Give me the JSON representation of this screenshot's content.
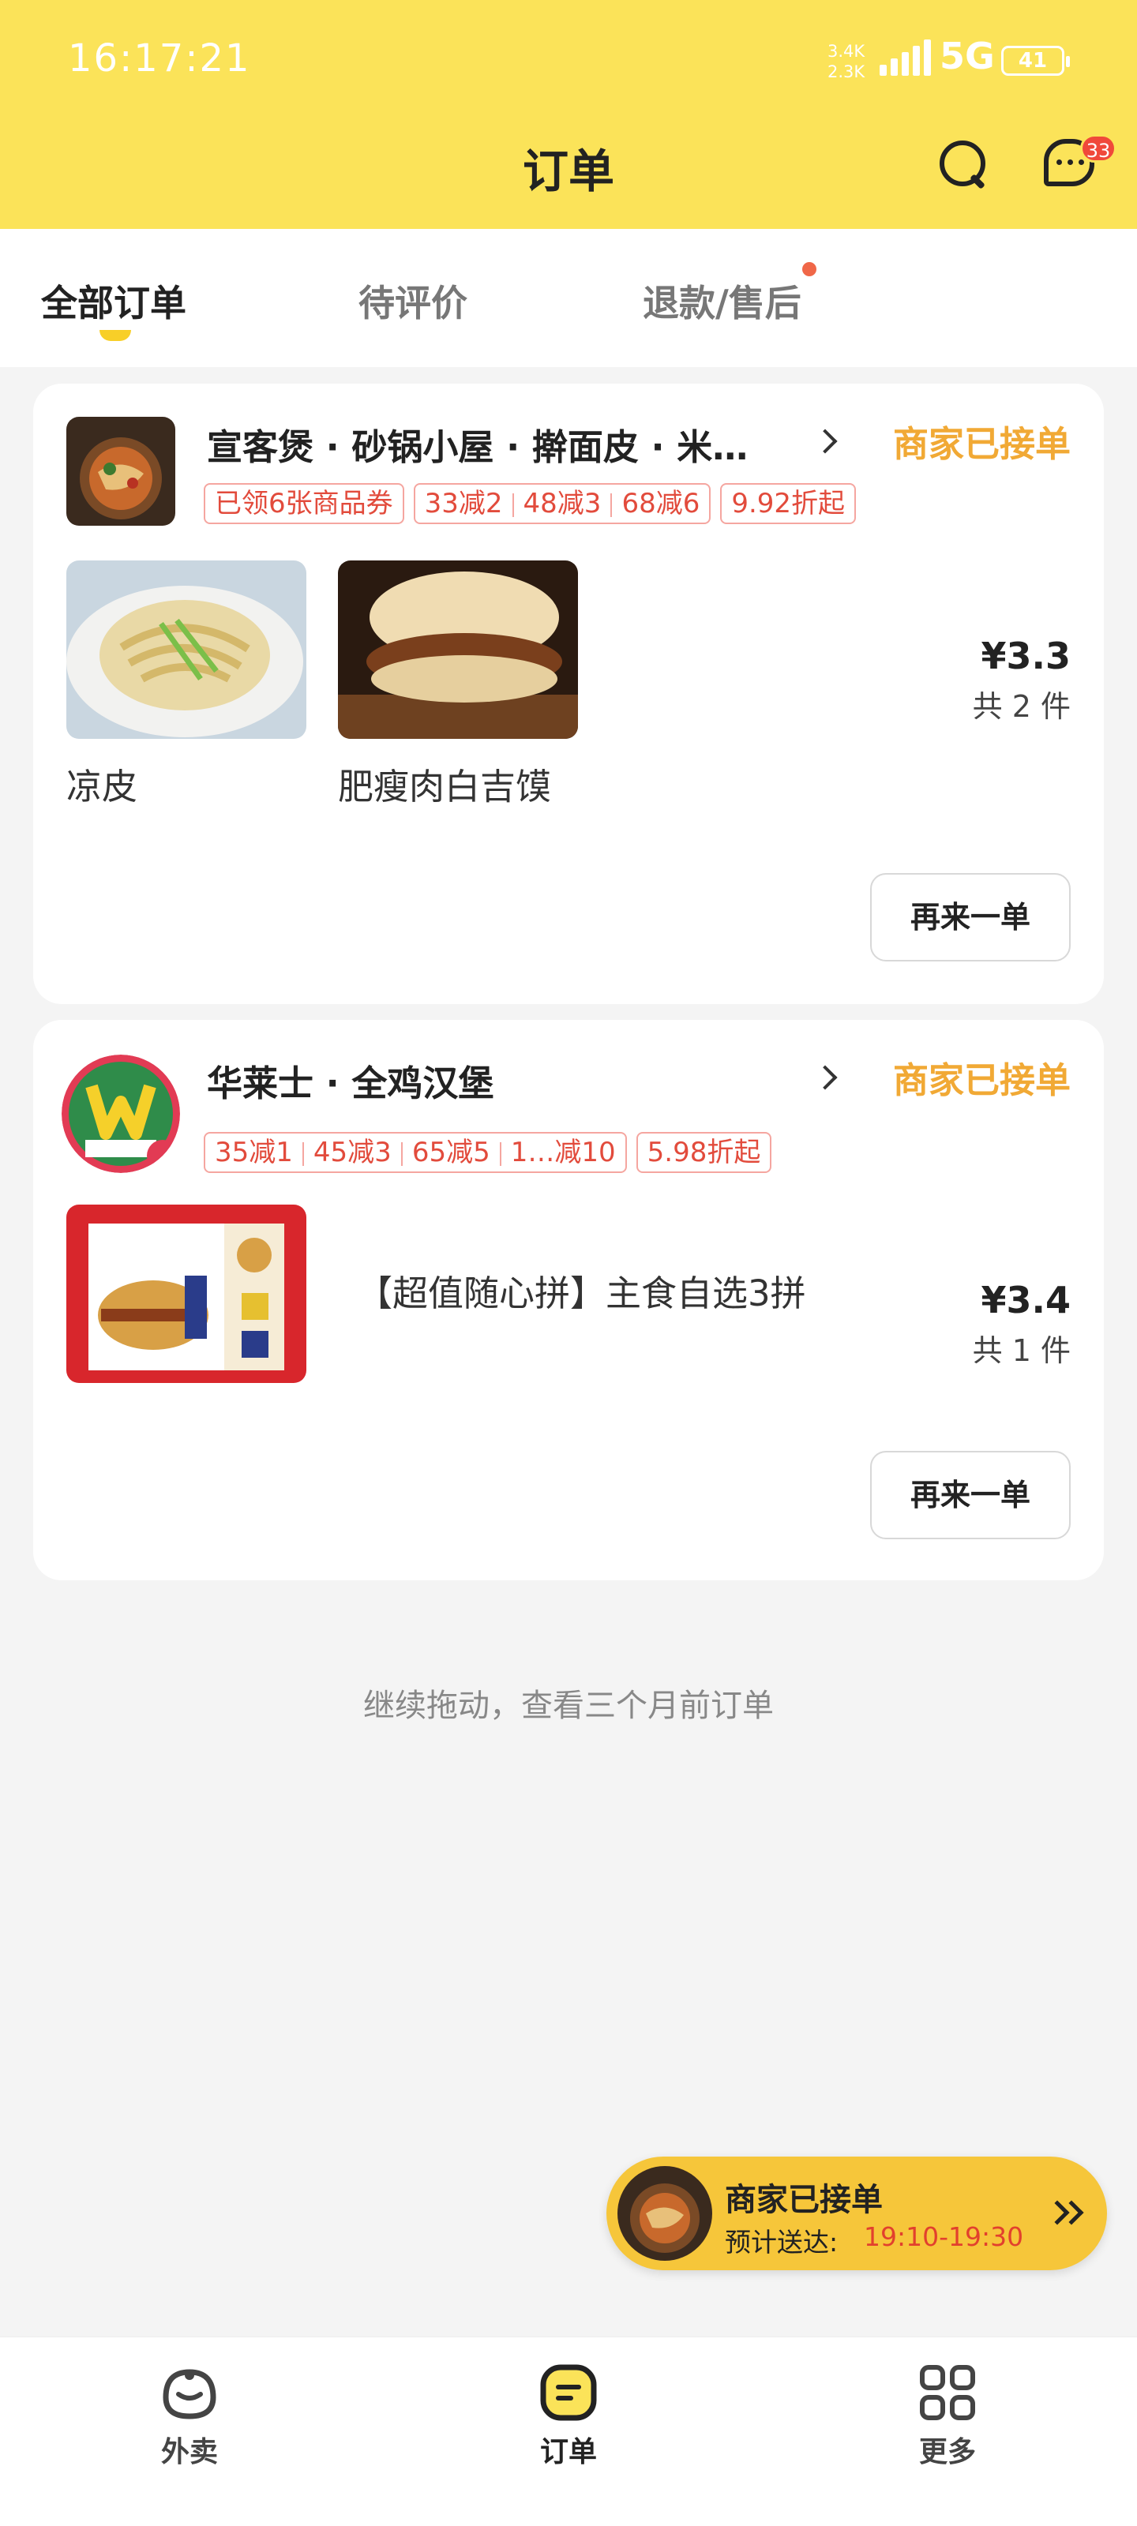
{
  "status_bar": {
    "time": "16:17:21",
    "net_up": "3.4K",
    "net_down": "2.3K",
    "network": "5G",
    "battery": "41"
  },
  "header": {
    "title": "订单",
    "message_badge": "33"
  },
  "tabs": [
    {
      "label": "全部订单"
    },
    {
      "label": "待评价"
    },
    {
      "label": "退款/售后"
    }
  ],
  "orders": [
    {
      "store": "宣客煲 · 砂锅小屋 · 擀面皮 · 米…",
      "status": "商家已接单",
      "tags": [
        "已领6张商品券",
        "33减2",
        "48减3",
        "68减6",
        "9.92折起"
      ],
      "items": [
        "凉皮",
        "肥瘦肉白吉馍"
      ],
      "price": "¥3.3",
      "count": "共 2 件",
      "reorder": "再来一单"
    },
    {
      "store": "华莱士 · 全鸡汉堡",
      "status": "商家已接单",
      "tags": [
        "35减1",
        "45减3",
        "65减5",
        "1…减10",
        "5.98折起"
      ],
      "items": [
        "【超值随心拼】主食自选3拼"
      ],
      "price": "¥3.4",
      "count": "共 1 件",
      "reorder": "再来一单"
    }
  ],
  "older_orders_hint": "继续拖动，查看三个月前订单",
  "floating_status": {
    "title": "商家已接单",
    "eta_label": "预计送达:",
    "eta": "19:10-19:30"
  },
  "bottom_nav": [
    {
      "label": "外卖"
    },
    {
      "label": "订单"
    },
    {
      "label": "更多"
    }
  ],
  "colors": {
    "header_bg": "#fbe359",
    "accent_orange": "#f1a935",
    "tag_red": "#e24b3c",
    "eta_red": "#e2402d"
  }
}
